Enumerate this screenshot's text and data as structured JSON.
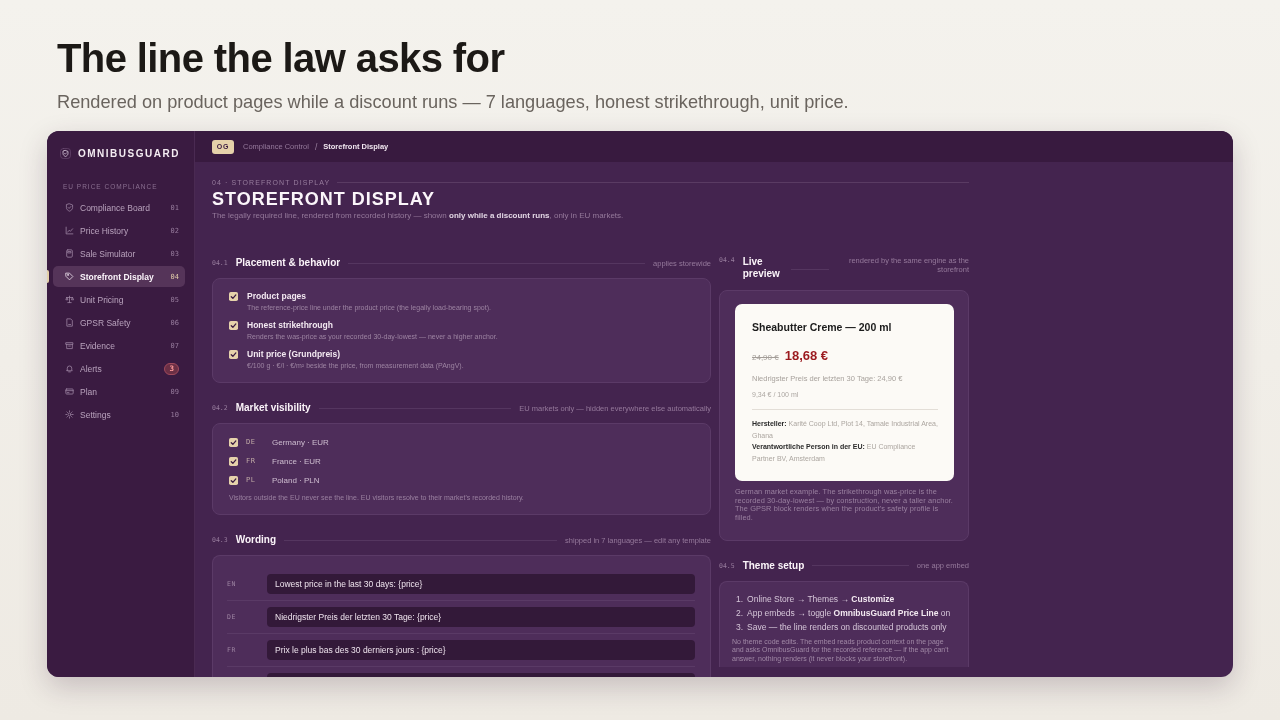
{
  "page": {
    "title": "The line the law asks for",
    "subtitle": "Rendered on product pages while a discount runs — 7 languages, honest strikethrough, unit price."
  },
  "sidebar": {
    "brand": "OMNIBUSGUARD",
    "section_label": "EU PRICE COMPLIANCE",
    "items": [
      {
        "label": "Compliance Board",
        "num": "01",
        "selected": false
      },
      {
        "label": "Price History",
        "num": "02",
        "selected": false
      },
      {
        "label": "Sale Simulator",
        "num": "03",
        "selected": false
      },
      {
        "label": "Storefront Display",
        "num": "04",
        "selected": true
      },
      {
        "label": "Unit Pricing",
        "num": "05",
        "selected": false
      },
      {
        "label": "GPSR Safety",
        "num": "06",
        "selected": false
      },
      {
        "label": "Evidence",
        "num": "07",
        "selected": false
      },
      {
        "label": "Alerts",
        "badge": "3",
        "selected": false
      },
      {
        "label": "Plan",
        "num": "09",
        "selected": false
      },
      {
        "label": "Settings",
        "num": "10",
        "selected": false
      }
    ]
  },
  "topbar": {
    "badge": "OG",
    "separator": "/",
    "breadcrumb": [
      {
        "label": "Compliance Control",
        "current": false
      },
      {
        "label": "Storefront Display",
        "current": true
      }
    ]
  },
  "header": {
    "eyebrow": "04 · STOREFRONT DISPLAY",
    "title": "STOREFRONT DISPLAY",
    "description": "The legally required line, rendered from recorded history — shown **only while a discount runs**, only in EU markets."
  },
  "placement": {
    "number": "04.1",
    "title": "Placement & behavior",
    "meta": "applies storewide",
    "options": [
      {
        "title": "Product pages",
        "description": "The reference-price line under the product price (the legally load-bearing spot).",
        "checked": true
      },
      {
        "title": "Honest strikethrough",
        "description": "Renders the was-price as your recorded 30-day-lowest — never a higher anchor.",
        "checked": true
      },
      {
        "title": "Unit price (Grundpreis)",
        "description": "€/100 g · €/l · €/m² beside the price, from measurement data (PAngV).",
        "checked": true
      }
    ]
  },
  "markets": {
    "number": "04.2",
    "title": "Market visibility",
    "meta": "EU markets only — hidden everywhere else automatically",
    "items": [
      {
        "code": "DE",
        "name": "Germany · EUR",
        "checked": true
      },
      {
        "code": "FR",
        "name": "France · EUR",
        "checked": true
      },
      {
        "code": "PL",
        "name": "Poland · PLN",
        "checked": true
      }
    ],
    "note": "Visitors outside the EU never see the line. EU visitors resolve to their market's recorded history."
  },
  "wording": {
    "number": "04.3",
    "title": "Wording",
    "meta": "shipped in 7 languages — edit any template",
    "rows": [
      {
        "lang": "EN",
        "value": "Lowest price in the last 30 days: {price}"
      },
      {
        "lang": "DE",
        "value": "Niedrigster Preis der letzten 30 Tage: {price}"
      },
      {
        "lang": "FR",
        "value": "Prix le plus bas des 30 derniers jours : {price}"
      }
    ],
    "continues": true
  },
  "preview": {
    "number": "04.4",
    "title": "Live preview",
    "meta": "rendered by the same engine as the storefront",
    "product": {
      "name": "Sheabutter Creme — 200 ml",
      "was_price": "24,90 €",
      "price": "18,68 €",
      "reference_line": "Niedrigster Preis der letzten 30 Tage: 24,90 €",
      "unit_price": "9,34 € / 100 ml",
      "gpsr": [
        "**Hersteller:** Karité Coop Ltd, Plot 14, Tamale Industrial Area, Ghana",
        "**Verantwortliche Person in der EU:** EU Compliance Partner BV, Amsterdam"
      ]
    },
    "caption": "German market example. The strikethrough was-price is the recorded 30-day-lowest — by construction, never a taller anchor. The GPSR block renders when the product's safety profile is filled."
  },
  "theme_setup": {
    "number": "04.5",
    "title": "Theme setup",
    "meta": "one app embed",
    "steps": [
      {
        "num": "1.",
        "text": "Online Store → Themes → **Customize**"
      },
      {
        "num": "2.",
        "text": "App embeds → toggle **OmnibusGuard Price Line** on"
      },
      {
        "num": "3.",
        "text": "Save — the line renders on discounted products only"
      }
    ],
    "note": "No theme code edits. The embed reads product context on the page and asks OmnibusGuard for the recorded reference — if the app can't answer, nothing renders (it never blocks your storefront)."
  }
}
